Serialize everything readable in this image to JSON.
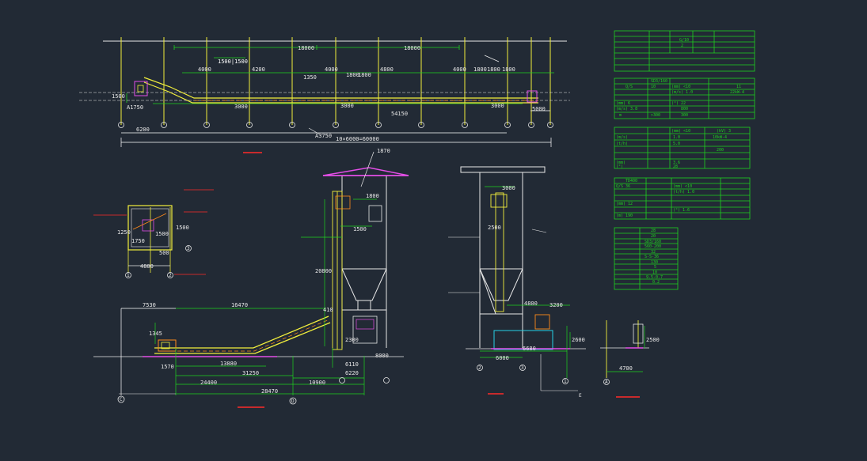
{
  "colors": {
    "background": "#222a35",
    "white": "#ffffff",
    "yellow": "#f2ef3c",
    "green": "#1fd31f",
    "red": "#ff2a2a",
    "magenta": "#e34ee6",
    "cyan": "#25d3e6",
    "orange": "#ff8a1a"
  },
  "plan_view": {
    "dims_top": [
      "18000",
      "18000",
      "1500|1500",
      "4000",
      "4200",
      "1350",
      "4000",
      "1800",
      "1800",
      "4800",
      "4000",
      "1800",
      "1800",
      "1800"
    ],
    "dims_mid": [
      "3000",
      "3000",
      "3000"
    ],
    "dims_bottom": [
      "54150",
      "6200",
      "10×6000=60000",
      "5000"
    ],
    "side_labels": [
      "1500",
      "A1750"
    ],
    "callout": "A3750",
    "axis_count": 12
  },
  "plan_detail": {
    "dims": [
      "4800",
      "1250",
      "1750",
      "1500",
      "1500",
      "500"
    ],
    "axis_labels": [
      "1",
      "2",
      "3"
    ]
  },
  "elevation_left": {
    "dims": [
      "7530",
      "16470",
      "1345",
      "13880",
      "1570",
      "31250",
      "24400",
      "28470",
      "10900",
      "6220",
      "6110",
      "8000"
    ],
    "vertical_dims": [
      "20800",
      "410",
      "2300",
      "1500",
      "1800",
      "1870"
    ],
    "axis_labels": [
      "C",
      "D"
    ]
  },
  "elevation_right": {
    "dims": [
      "3000",
      "2500",
      "4800",
      "3200",
      "6000",
      "6680",
      "2600"
    ],
    "axis_labels": [
      "2",
      "3",
      "1",
      "E"
    ]
  },
  "small_detail": {
    "dims": [
      "2500",
      "4700"
    ],
    "axis_label": "A"
  },
  "tables": [
    {
      "rows": [
        [
          "",
          "",
          "G/10",
          ""
        ],
        [
          "",
          "",
          "2",
          ""
        ],
        [
          "",
          "",
          "",
          ""
        ],
        [
          "",
          "",
          "",
          ""
        ],
        [
          "",
          "",
          "",
          ""
        ],
        [
          "",
          "",
          "",
          ""
        ],
        [
          "",
          "",
          "",
          ""
        ]
      ]
    },
    {
      "rows": [
        [
          "",
          "SD3/160",
          "",
          ""
        ],
        [
          "Q/S",
          "10",
          "(mm) <10",
          "11"
        ],
        [
          "",
          "",
          "(m/s) 1.0",
          "22kW-4"
        ],
        [
          "",
          "",
          "",
          ""
        ],
        [
          "(mm) 6",
          "",
          "(°) 22",
          ""
        ],
        [
          "(m/s) 3.8",
          "",
          "800",
          ""
        ],
        [
          "m",
          ">300",
          "300",
          ""
        ]
      ]
    },
    {
      "rows": [
        [
          "",
          "(mm) <10",
          "(kV) 3",
          ""
        ],
        [
          "(m/s)",
          "1.0",
          "10kW-4",
          ""
        ],
        [
          "(t/h)",
          "5.0",
          "",
          ""
        ],
        [
          "",
          "",
          "200",
          ""
        ],
        [
          "(mm)",
          "3.6",
          "",
          ""
        ],
        [
          "(°)",
          "28",
          "",
          ""
        ]
      ]
    },
    {
      "rows": [
        [
          "TD400",
          "",
          "",
          ""
        ],
        [
          "Q/S 36",
          "(mm) <10",
          "",
          ""
        ],
        [
          "",
          "(t/h) 1.0",
          "",
          ""
        ],
        [
          "",
          "",
          "",
          ""
        ],
        [
          "(mm) 12",
          "",
          "",
          ""
        ],
        [
          "",
          "(°) 1.6",
          "",
          ""
        ],
        [
          "(m) 190",
          "",
          "",
          ""
        ]
      ]
    },
    {
      "rows": [
        [
          "",
          "28"
        ],
        [
          "",
          "20"
        ],
        [
          "",
          "SD3/160"
        ],
        [
          "",
          "560-200"
        ],
        [
          "",
          "32"
        ],
        [
          "",
          "S-S-36"
        ],
        [
          "",
          "130"
        ],
        [
          "",
          "5"
        ],
        [
          "",
          "10"
        ],
        [
          "",
          "9.5-0.7"
        ],
        [
          "",
          "0.2"
        ],
        [
          "",
          ""
        ]
      ]
    }
  ]
}
